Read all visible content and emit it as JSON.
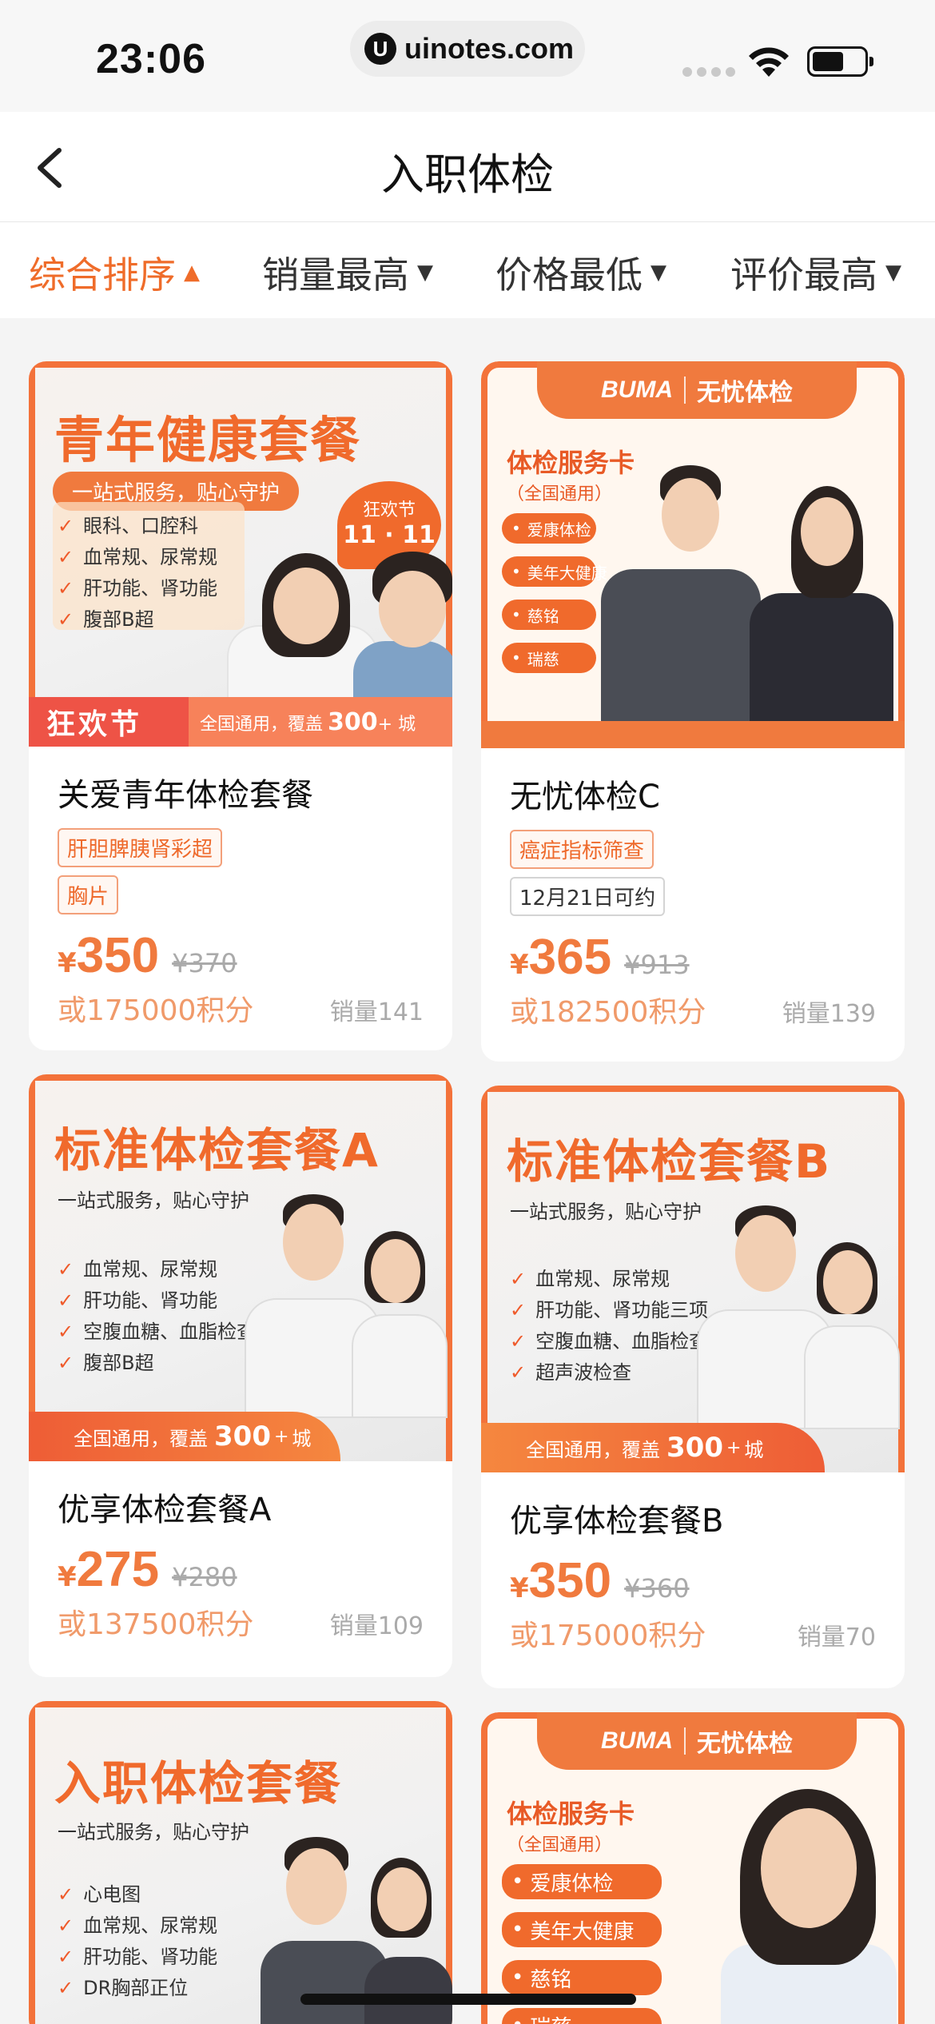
{
  "status_bar": {
    "time": "23:06",
    "url": "uinotes.com",
    "url_logo": "U"
  },
  "nav": {
    "title": "入职体检",
    "back_icon": "chevron-left-icon"
  },
  "sort": [
    {
      "label": "综合排序",
      "arrow": "▲",
      "active": true
    },
    {
      "label": "销量最高",
      "arrow": "▼",
      "active": false
    },
    {
      "label": "价格最低",
      "arrow": "▼",
      "active": false
    },
    {
      "label": "评价最高",
      "arrow": "▼",
      "active": false
    }
  ],
  "products": [
    {
      "banner": {
        "title": "青年健康套餐",
        "pill": "一站式服务，贴心守护",
        "list": [
          "眼科、口腔科",
          "血常规、尿常规",
          "肝功能、肾功能",
          "腹部B超"
        ],
        "badge_top": "狂欢节",
        "badge_nums": "11 · 11",
        "ribbon_left": "狂欢节",
        "ribbon_text": "全国通用，覆盖",
        "ribbon_num": "300",
        "ribbon_plus": "+",
        "ribbon_unit": "城"
      },
      "name": "关爱青年体检套餐",
      "tags": [
        "肝胆脾胰肾彩超",
        "胸片"
      ],
      "currency": "¥",
      "price": "350",
      "original": "¥370",
      "points": "或175000积分",
      "sold": "销量141"
    },
    {
      "banner": {
        "logo": "BUMA",
        "tag": "无忧体检",
        "title": "体检服务卡",
        "sub": "（全国通用）",
        "pills": [
          "爱康体检",
          "美年大健康",
          "慈铭",
          "瑞慈"
        ]
      },
      "name": "无忧体检C",
      "tags": [
        "癌症指标筛查"
      ],
      "gray_tag": "12月21日可约",
      "currency": "¥",
      "price": "365",
      "original": "¥913",
      "points": "或182500积分",
      "sold": "销量139"
    },
    {
      "banner": {
        "title": "标准体检套餐A",
        "sub": "一站式服务，贴心守护",
        "list": [
          "血常规、尿常规",
          "肝功能、肾功能",
          "空腹血糖、血脂检查",
          "腹部B超"
        ],
        "bottom_text": "全国通用，覆盖",
        "bottom_num": "300",
        "bottom_plus": "+",
        "bottom_unit": "城"
      },
      "name": "优享体检套餐A",
      "currency": "¥",
      "price": "275",
      "original": "¥280",
      "points": "或137500积分",
      "sold": "销量109"
    },
    {
      "banner": {
        "title": "标准体检套餐B",
        "sub": "一站式服务，贴心守护",
        "list": [
          "血常规、尿常规",
          "肝功能、肾功能三项",
          "空腹血糖、血脂检查",
          "超声波检查"
        ],
        "bottom_text": "全国通用，覆盖",
        "bottom_num": "300",
        "bottom_plus": "+",
        "bottom_unit": "城"
      },
      "name": "优享体检套餐B",
      "currency": "¥",
      "price": "350",
      "original": "¥360",
      "points": "或175000积分",
      "sold": "销量70"
    },
    {
      "banner": {
        "title": "入职体检套餐",
        "sub": "一站式服务，贴心守护",
        "list": [
          "心电图",
          "血常规、尿常规",
          "肝功能、肾功能",
          "DR胸部正位"
        ]
      }
    },
    {
      "banner": {
        "logo": "BUMA",
        "tag": "无忧体检",
        "title": "体检服务卡",
        "sub": "（全国通用）",
        "pills": [
          "爱康体检",
          "美年大健康",
          "慈铭",
          "瑞慈"
        ]
      }
    }
  ],
  "colors": {
    "accent": "#ef6c2a",
    "price": "#f07a3e",
    "points": "#f09a6a",
    "muted": "#aaaaaa"
  }
}
